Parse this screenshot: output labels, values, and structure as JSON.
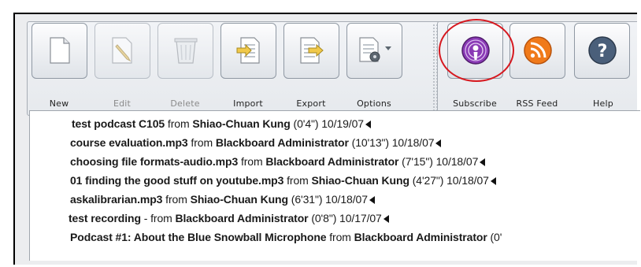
{
  "toolbar": {
    "buttons": [
      {
        "label": "New",
        "icon": "new-document-icon",
        "enabled": true
      },
      {
        "label": "Edit",
        "icon": "edit-pencil-icon",
        "enabled": false
      },
      {
        "label": "Delete",
        "icon": "trash-icon",
        "enabled": false
      },
      {
        "label": "Import",
        "icon": "import-icon",
        "enabled": true
      },
      {
        "label": "Export",
        "icon": "export-icon",
        "enabled": true
      },
      {
        "label": "Options",
        "icon": "options-gear-icon",
        "enabled": true
      }
    ],
    "right_buttons": [
      {
        "label": "Subscribe",
        "icon": "podcast-icon",
        "color": "#7b2fa3"
      },
      {
        "label": "RSS Feed",
        "icon": "rss-icon",
        "color": "#f07a1a"
      },
      {
        "label": "Help",
        "icon": "help-icon",
        "color": "#4a5f7a"
      }
    ]
  },
  "colors": {
    "annotation": "#d6181f"
  },
  "episodes": [
    {
      "title": "test podcast C105",
      "sep": "from",
      "author": "Shiao-Chuan Kung",
      "meta": "(0'4\") 10/19/07"
    },
    {
      "title": "course evaluation.mp3",
      "sep": "from",
      "author": "Blackboard Administrator",
      "meta": "(10'13\") 10/18/07"
    },
    {
      "title": "choosing file formats-audio.mp3",
      "sep": "from",
      "author": "Blackboard Administrator",
      "meta": "(7'15\") 10/18/07"
    },
    {
      "title": "01 finding the good stuff on youtube.mp3",
      "sep": "from",
      "author": "Shiao-Chuan Kung",
      "meta": "(4'27\") 10/18/07"
    },
    {
      "title": "askalibrarian.mp3",
      "sep": "from",
      "author": "Shiao-Chuan Kung",
      "meta": "(6'31\") 10/18/07"
    },
    {
      "title": "test recording",
      "sep": "- from",
      "author": "Blackboard Administrator",
      "meta": "(0'8\") 10/17/07"
    },
    {
      "title": "Podcast #1: About the Blue Snowball Microphone",
      "sep": "from",
      "author": "Blackboard Administrator",
      "meta": "(0'"
    }
  ]
}
